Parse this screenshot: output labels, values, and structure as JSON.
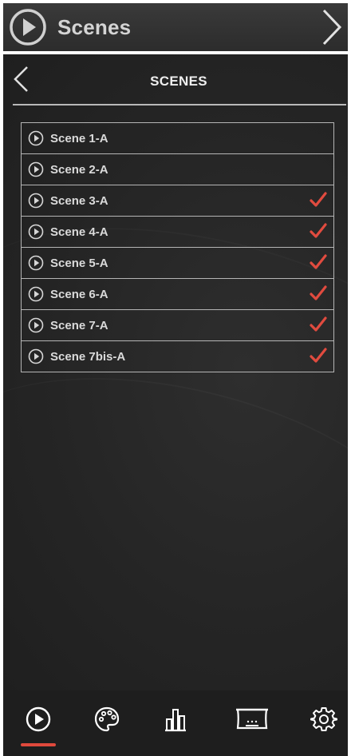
{
  "header": {
    "title": "Scenes",
    "icon": "play-circle-icon",
    "next_icon": "chevron-right-icon"
  },
  "panel": {
    "title": "SCENES",
    "back_icon": "chevron-left-icon"
  },
  "scenes": [
    {
      "label": "Scene 1-A",
      "checked": false
    },
    {
      "label": "Scene 2-A",
      "checked": false
    },
    {
      "label": "Scene 3-A",
      "checked": true
    },
    {
      "label": "Scene 4-A",
      "checked": true
    },
    {
      "label": "Scene 5-A",
      "checked": true
    },
    {
      "label": "Scene 6-A",
      "checked": true
    },
    {
      "label": "Scene 7-A",
      "checked": true
    },
    {
      "label": "Scene 7bis-A",
      "checked": true
    }
  ],
  "bottom_nav": {
    "items": [
      {
        "icon": "play-circle-icon",
        "active": true
      },
      {
        "icon": "palette-icon",
        "active": false
      },
      {
        "icon": "bar-chart-icon",
        "active": false
      },
      {
        "icon": "stage-icon",
        "active": false
      },
      {
        "icon": "gear-icon",
        "active": false
      }
    ]
  },
  "colors": {
    "accent": "#e0493c",
    "check": "#e14b3f",
    "text": "#dadada",
    "header_bg": "#333333",
    "panel_bg": "#262626"
  }
}
